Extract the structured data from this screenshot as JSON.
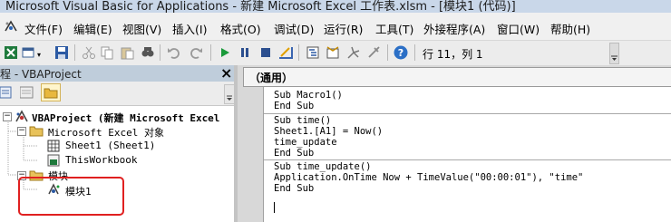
{
  "window": {
    "title": "Microsoft Visual Basic for Applications - 新建 Microsoft Excel 工作表.xlsm - [模块1 (代码)]"
  },
  "menu": {
    "items": [
      "文件(F)",
      "编辑(E)",
      "视图(V)",
      "插入(I)",
      "格式(O)",
      "调试(D)",
      "运行(R)",
      "工具(T)",
      "外接程序(A)",
      "窗口(W)",
      "帮助(H)"
    ]
  },
  "toolbar": {
    "position_label": "行 11，列 1"
  },
  "project_panel": {
    "title": "程 - VBAProject",
    "close_glyph": "×",
    "tree": {
      "project": "VBAProject (新建 Microsoft Excel",
      "excel_objects": "Microsoft Excel 对象",
      "sheet1": "Sheet1 (Sheet1)",
      "thisworkbook": "ThisWorkbook",
      "modules": "模块",
      "module1": "模块1"
    }
  },
  "code_window": {
    "object_dropdown": "（通用）",
    "blocks": [
      [
        "Sub Macro1()",
        "End Sub"
      ],
      [
        "Sub time()",
        "Sheet1.[A1] = Now()",
        "time_update",
        "End Sub"
      ],
      [
        "Sub time_update()",
        "Application.OnTime Now + TimeValue(\"00:00:01\"), \"time\"",
        "End Sub"
      ]
    ]
  },
  "colors": {
    "highlight_box": "#e02020",
    "title_bar": "#c9d7e9",
    "panel_header": "#bfcddb"
  }
}
